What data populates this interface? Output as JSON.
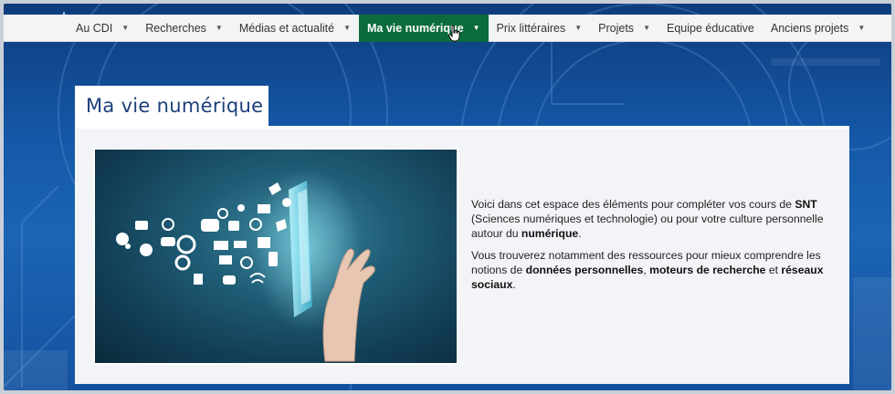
{
  "nav": {
    "items": [
      {
        "label": "Au CDI",
        "caret": true,
        "active": false
      },
      {
        "label": "Recherches",
        "caret": true,
        "active": false
      },
      {
        "label": "Médias et actualité",
        "caret": true,
        "active": false
      },
      {
        "label": "Ma vie numérique",
        "caret": true,
        "active": true
      },
      {
        "label": "Prix littéraires",
        "caret": true,
        "active": false
      },
      {
        "label": "Projets",
        "caret": true,
        "active": false
      },
      {
        "label": "Equipe éducative",
        "caret": false,
        "active": false
      },
      {
        "label": "Anciens projets",
        "caret": true,
        "active": false
      }
    ],
    "caret_glyph": "▼",
    "active_color": "#0b6b3a"
  },
  "page": {
    "title": "Ma vie numérique",
    "paragraph1": {
      "t1": "Voici dans cet espace des éléments pour compléter vos cours de ",
      "b1": "SNT",
      "t2": " (Sciences numériques et technologie) ou pour votre culture personnelle autour du ",
      "b2": "numérique",
      "t3": "."
    },
    "paragraph2": {
      "t1": "Vous trouverez notamment des ressources pour mieux comprendre les notions de ",
      "b1": "données personnelles",
      "t2": ", ",
      "b2": "moteurs de recherche",
      "t3": " et ",
      "b3": "réseaux sociaux",
      "t4": "."
    }
  },
  "colors": {
    "background": "#1558a8",
    "title": "#1d3f7a",
    "panel": "#f2f4f7"
  }
}
